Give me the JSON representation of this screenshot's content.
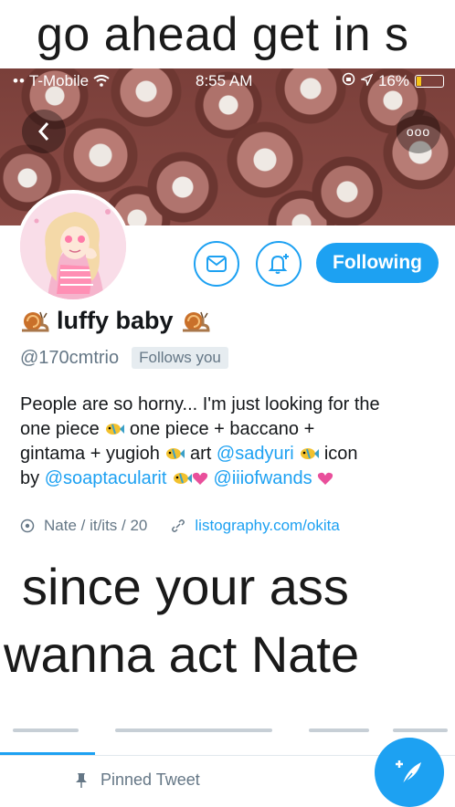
{
  "captions": {
    "top": "go ahead get in s",
    "middle_line1": "since your ass",
    "middle_line2": "wanna act Nate"
  },
  "status_bar": {
    "carrier": "T-Mobile",
    "time": "8:55 AM",
    "battery": "16%"
  },
  "profile": {
    "name": "luffy baby",
    "handle": "@170cmtrio",
    "follows_you": "Follows you",
    "follow_button": "Following",
    "bio": {
      "line1": "People are so horny... I'm just looking for the",
      "line2_a": "one piece",
      "line2_b": "one piece + baccano +",
      "line3_a": "gintama + yugioh",
      "line3_b": "art",
      "line3_link": "@sadyuri",
      "line3_c": "icon",
      "line4_a": "by",
      "line4_link1": "@soaptacularit",
      "line4_link2": "@iiiofwands"
    },
    "location": "Nate / it/its / 20",
    "website": "listography.com/okita"
  },
  "pinned_label": "Pinned Tweet",
  "colors": {
    "accent": "#1da1f2",
    "text": "#14171a",
    "muted": "#657786"
  },
  "icons": {
    "back": "chevron-left-icon",
    "more": "more-icon",
    "message": "envelope-icon",
    "notify": "bell-plus-icon",
    "location": "location-pin-icon",
    "link": "link-icon",
    "pin": "pin-icon",
    "compose": "compose-feather-icon"
  }
}
